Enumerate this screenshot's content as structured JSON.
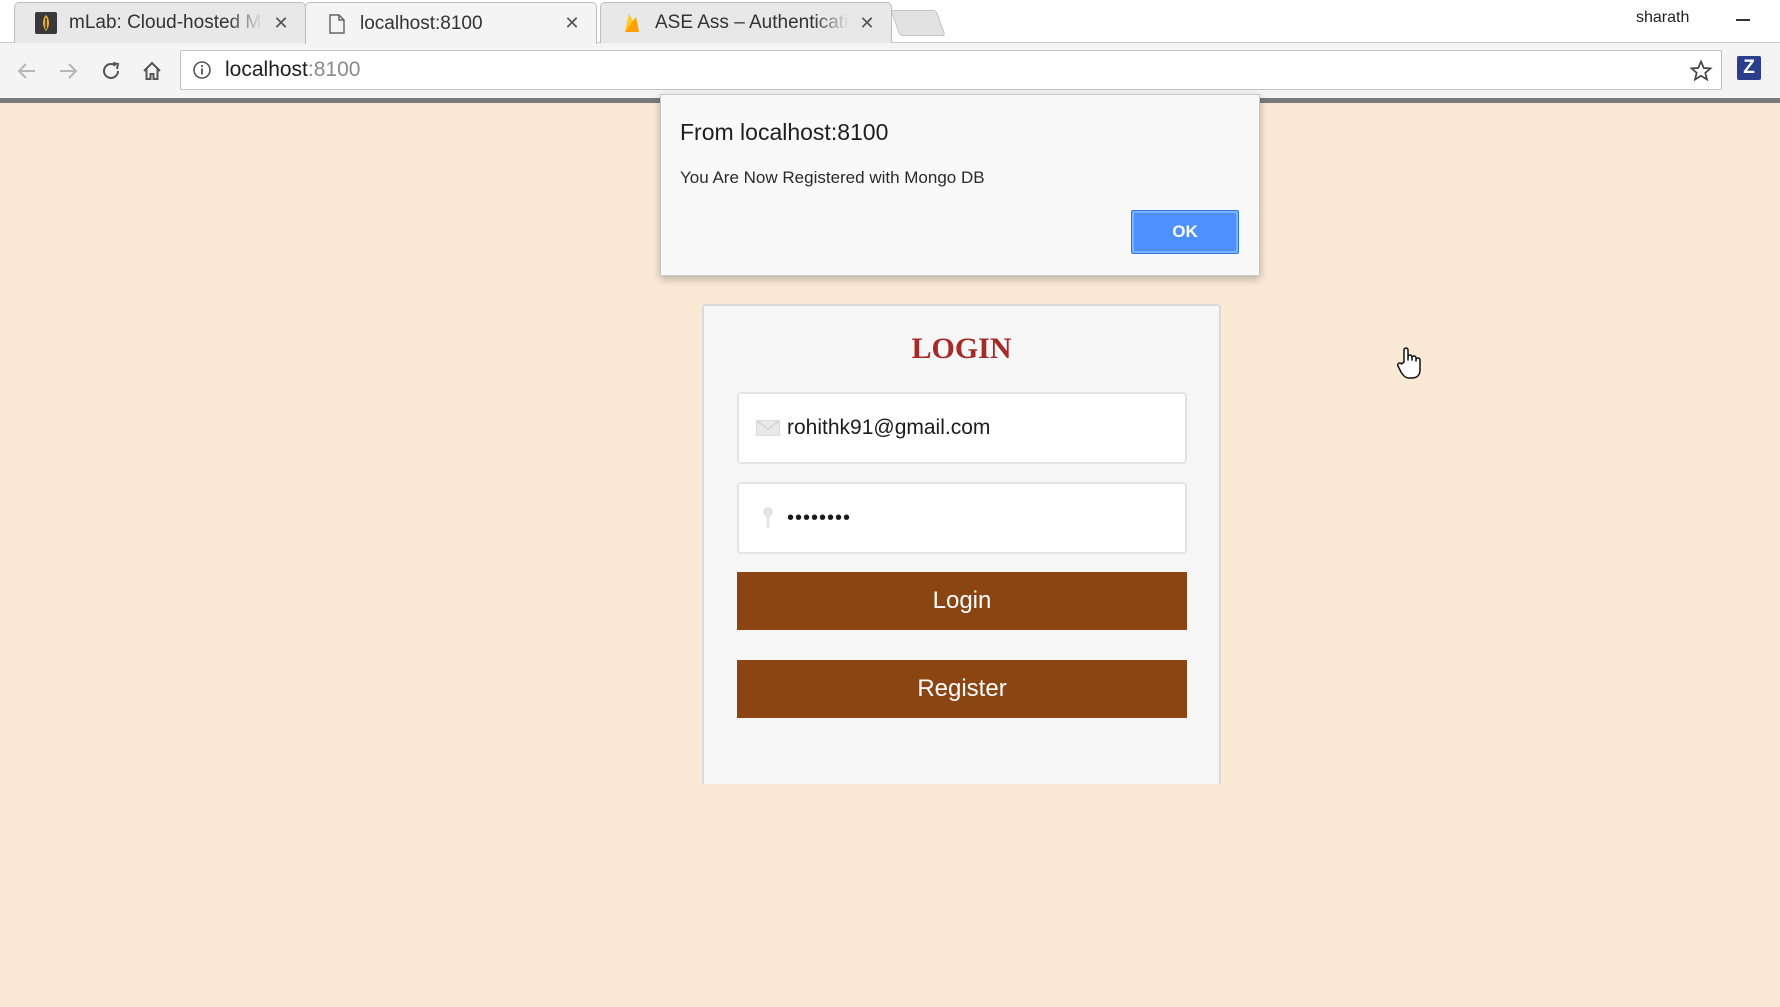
{
  "tabs": [
    {
      "title": "mLab: Cloud-hosted MongoDB",
      "icon": "mlab-favicon-icon"
    },
    {
      "title": "localhost:8100",
      "icon": "page-icon",
      "active": true
    },
    {
      "title": "ASE Ass – Authentication",
      "icon": "firebase-favicon-icon"
    }
  ],
  "profile": {
    "name": "sharath"
  },
  "omnibox": {
    "host": "localhost",
    "port": ":8100"
  },
  "extension": {
    "label": "Z"
  },
  "dialog": {
    "title": "From localhost:8100",
    "message": "You Are Now Registered with Mongo DB",
    "ok_label": "OK"
  },
  "login": {
    "heading": "LOGIN",
    "email_value": "rohithk91@gmail.com",
    "password_mask": "••••••••",
    "login_label": "Login",
    "register_label": "Register"
  },
  "colors": {
    "page_background": "#f9e9d5",
    "heading": "#a52a2a",
    "button": "#8b4513",
    "dialog_ok": "#4d90fe"
  }
}
